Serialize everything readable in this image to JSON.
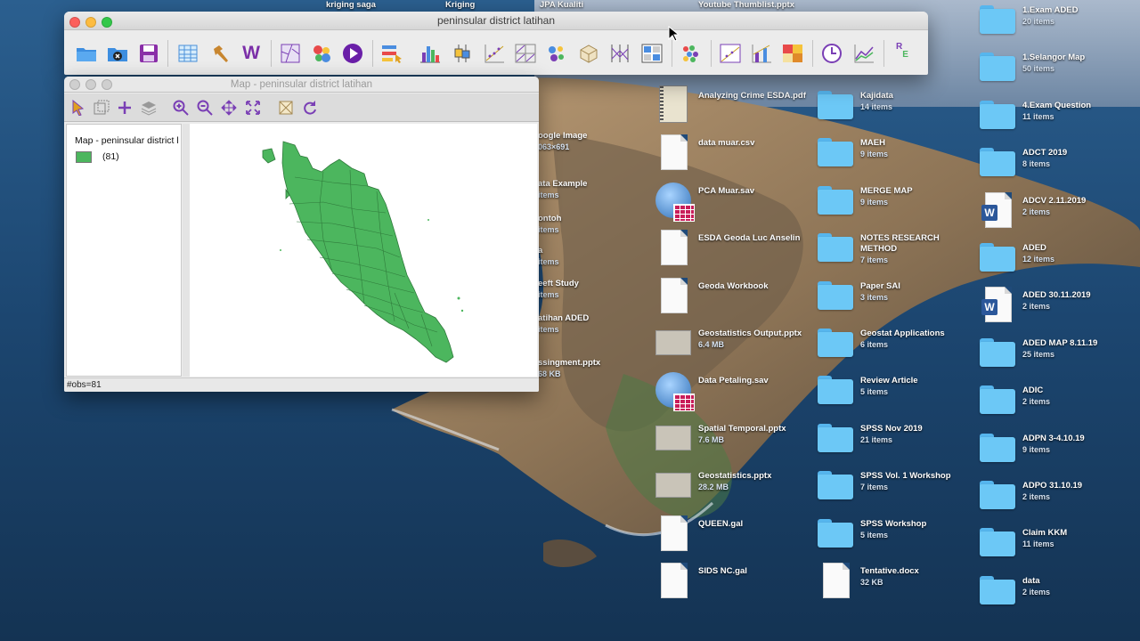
{
  "main_window": {
    "title": "peninsular district latihan",
    "tools": [
      "open-folder",
      "close-project",
      "save",
      "table",
      "hammer-tool",
      "weights-manager",
      "map",
      "cartogram",
      "animation",
      "category-editor",
      "histogram",
      "box-plot",
      "scatter-plot",
      "scatter-plot-matrix",
      "bubble-chart",
      "3d-plot",
      "parallel-coordinate",
      "conditional-plot",
      "cluster",
      "scatter-regression",
      "averages-chart",
      "heatmap",
      "time-editor",
      "line-chart",
      "regression"
    ],
    "tool_glyph": {
      "weights": "W",
      "regression_r": "R",
      "regression_e": "E"
    }
  },
  "map_window": {
    "title": "Map - peninsular district latihan",
    "legend_title": "Map - peninsular district l",
    "legend_item_count": "(81)",
    "fill_color": "#4cb65e",
    "status": "#obs=81"
  },
  "desktop_left_partial": [
    {
      "name": "oogle Image",
      "sub": "063×691"
    },
    {
      "name": "ata Example",
      "sub": "items"
    },
    {
      "name": "ontoh",
      "sub": "items"
    },
    {
      "name": "a",
      "sub": "items"
    },
    {
      "name": "eeft Study",
      "sub": "items"
    },
    {
      "name": "atihan ADED",
      "sub": "items"
    },
    {
      "name": "ssingment.pptx",
      "sub": "68 KB"
    }
  ],
  "desktop_top": [
    {
      "name": "kriging saga"
    },
    {
      "name": "Kriging"
    },
    {
      "name": "JPA Kualiti"
    },
    {
      "name": "Youtube Thumblist.pptx"
    }
  ],
  "desktop_col1": [
    {
      "name": "Analyzing Crime ESDA.pdf",
      "sub": "",
      "icon": "pdf"
    },
    {
      "name": "data muar.csv",
      "sub": "",
      "icon": "doc"
    },
    {
      "name": "PCA Muar.sav",
      "sub": "",
      "icon": "sav"
    },
    {
      "name": "ESDA Geoda Luc Anselin",
      "sub": "",
      "icon": "doc"
    },
    {
      "name": "Geoda Workbook",
      "sub": "",
      "icon": "doc"
    },
    {
      "name": "Geostatistics Output.pptx",
      "sub": "6.4 MB",
      "icon": "thumb"
    },
    {
      "name": "Data Petaling.sav",
      "sub": "",
      "icon": "sav"
    },
    {
      "name": "Spatial Temporal.pptx",
      "sub": "7.6 MB",
      "icon": "thumb"
    },
    {
      "name": "Geostatistics.pptx",
      "sub": "28.2 MB",
      "icon": "thumb"
    },
    {
      "name": "QUEEN.gal",
      "sub": "",
      "icon": "doc"
    },
    {
      "name": "SIDS NC.gal",
      "sub": "",
      "icon": "doc"
    }
  ],
  "desktop_col2": [
    {
      "name": "Kajidata",
      "sub": "14 items",
      "icon": "folder"
    },
    {
      "name": "MAEH",
      "sub": "9 items",
      "icon": "folder"
    },
    {
      "name": "MERGE MAP",
      "sub": "9 items",
      "icon": "folder"
    },
    {
      "name": "NOTES RESEARCH METHOD",
      "sub": "7 items",
      "icon": "folder"
    },
    {
      "name": "Paper SAI",
      "sub": "3 items",
      "icon": "folder"
    },
    {
      "name": "Geostat Applications",
      "sub": "6 items",
      "icon": "folder"
    },
    {
      "name": "Review Article",
      "sub": "5 items",
      "icon": "folder"
    },
    {
      "name": "SPSS Nov 2019",
      "sub": "21 items",
      "icon": "folder"
    },
    {
      "name": "SPSS Vol. 1 Workshop",
      "sub": "7 items",
      "icon": "folder"
    },
    {
      "name": "SPSS Workshop",
      "sub": "5 items",
      "icon": "folder"
    },
    {
      "name": "Tentative.docx",
      "sub": "32 KB",
      "icon": "doc"
    }
  ],
  "desktop_col3": [
    {
      "name": "1.Exam ADED",
      "sub": "20 items",
      "icon": "folder"
    },
    {
      "name": "1.Selangor Map",
      "sub": "50 items",
      "icon": "folder"
    },
    {
      "name": "4.Exam Question",
      "sub": "11 items",
      "icon": "folder"
    },
    {
      "name": "ADCT 2019",
      "sub": "8 items",
      "icon": "folder"
    },
    {
      "name": "ADCV 2.11.2019",
      "sub": "2 items",
      "icon": "word"
    },
    {
      "name": "ADED",
      "sub": "12 items",
      "icon": "folder"
    },
    {
      "name": "ADED 30.11.2019",
      "sub": "2 items",
      "icon": "word"
    },
    {
      "name": "ADED MAP 8.11.19",
      "sub": "25 items",
      "icon": "folder"
    },
    {
      "name": "ADIC",
      "sub": "2 items",
      "icon": "folder"
    },
    {
      "name": "ADPN 3-4.10.19",
      "sub": "9 items",
      "icon": "folder"
    },
    {
      "name": "ADPO 31.10.19",
      "sub": "2 items",
      "icon": "folder"
    },
    {
      "name": "Claim KKM",
      "sub": "11 items",
      "icon": "folder"
    },
    {
      "name": "data",
      "sub": "2 items",
      "icon": "folder"
    }
  ],
  "colors": {
    "sea": "#1d3f66",
    "folder": "#6cc8f6",
    "map_fill": "#4cb65e"
  }
}
